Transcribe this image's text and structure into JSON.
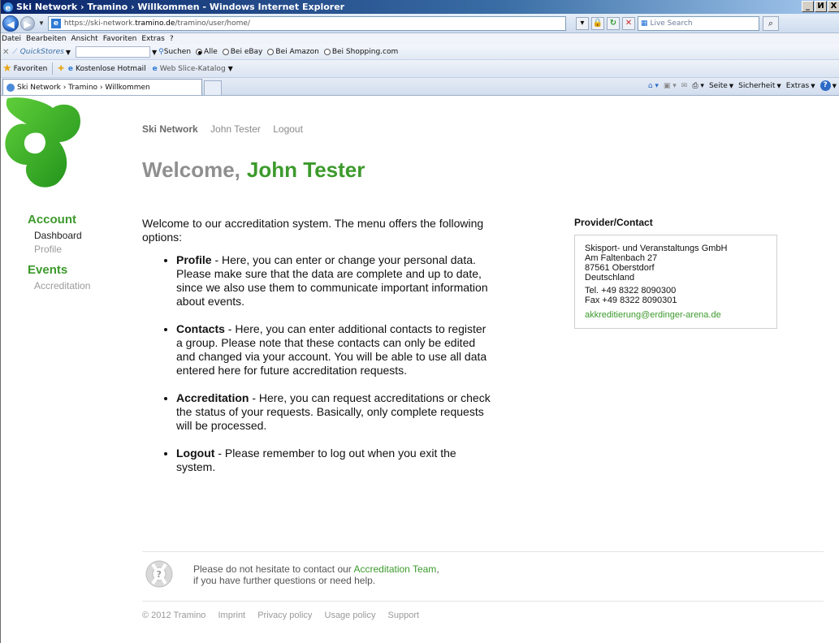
{
  "browser": {
    "window_title": "Ski Network › Tramino › Willkommen - Windows Internet Explorer",
    "window_buttons": [
      "_",
      "И",
      "X"
    ],
    "url_prefix": "https://ski-network.",
    "url_host": "tramino.de",
    "url_path": "/tramino/user/home/",
    "search_placeholder": "Live Search",
    "menu": [
      "Datei",
      "Bearbeiten",
      "Ansicht",
      "Favoriten",
      "Extras",
      "?"
    ],
    "quickstores_label": "QuickStores",
    "search_button": "Suchen",
    "radio_options": [
      {
        "label": "Alle",
        "selected": true
      },
      {
        "label": "Bei eBay",
        "selected": false
      },
      {
        "label": "Bei Amazon",
        "selected": false
      },
      {
        "label": "Bei Shopping.com",
        "selected": false
      }
    ],
    "favorites_label": "Favoriten",
    "favorites_items": [
      "Kostenlose Hotmail",
      "Web Slice-Katalog"
    ],
    "tab_title": "Ski Network › Tramino › Willkommen",
    "command_bar": [
      "Seite",
      "Sicherheit",
      "Extras"
    ]
  },
  "page": {
    "topnav": {
      "brand": "Ski Network",
      "user": "John Tester",
      "logout": "Logout"
    },
    "welcome_prefix": "Welcome,",
    "welcome_name": "John Tester",
    "sidebar": {
      "account_heading": "Account",
      "account_items": [
        "Dashboard",
        "Profile"
      ],
      "events_heading": "Events",
      "events_items": [
        "Accreditation"
      ]
    },
    "intro": "Welcome to our accreditation system. The menu offers the following options:",
    "options": [
      {
        "term": "Profile",
        "text": " - Here, you can enter or change your personal data. Please make sure that the data are complete and up to date, since we also use them to communicate important information about events."
      },
      {
        "term": "Contacts",
        "text": " - Here, you can enter additional contacts to register a group. Please note that these contacts can only be edited and changed via your account. You will be able to use all data entered here for future accreditation requests."
      },
      {
        "term": "Accreditation",
        "text": " - Here, you can request accreditations or check the status of your requests. Basically, only complete requests will be processed."
      },
      {
        "term": "Logout",
        "text": " - Please remember to log out when you exit the system."
      }
    ],
    "provider": {
      "heading": "Provider/Contact",
      "company": "Skisport- und Veranstaltungs GmbH",
      "street": "Am Faltenbach 27",
      "city": "87561 Oberstdorf",
      "country": "Deutschland",
      "tel": "Tel. +49 8322 8090300",
      "fax": "Fax +49 8322 8090301",
      "email": "akkreditierung@erdinger-arena.de"
    },
    "help": {
      "line1_prefix": "Please do not hesitate to contact our ",
      "link": "Accreditation Team",
      "line1_suffix": ",",
      "line2": "if you have further questions or need help."
    },
    "footer": [
      "© 2012 Tramino",
      "Imprint",
      "Privacy policy",
      "Usage policy",
      "Support"
    ],
    "colors": {
      "brand_green": "#3c9a2c",
      "gray_heading": "#8f8f8f"
    }
  }
}
